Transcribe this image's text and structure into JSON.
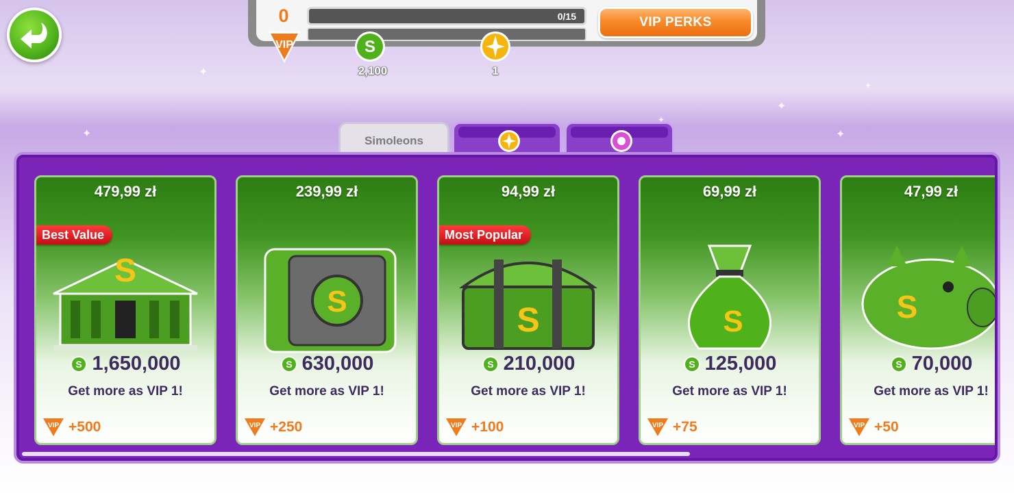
{
  "hud": {
    "vip_level": "0",
    "vip_label": "VIP",
    "vip_progress_text": "0/15",
    "vip_progress_fraction": 0,
    "vip_perks_label": "VIP PERKS",
    "simoleons_value": "2,100",
    "lifestyle_points_value": "1"
  },
  "tabs": [
    {
      "label": "Simoleons",
      "icon": "simoleon-icon",
      "active": true
    },
    {
      "label": "",
      "icon": "lifestyle-points-icon",
      "active": false
    },
    {
      "label": "",
      "icon": "social-points-icon",
      "active": false
    }
  ],
  "cards": [
    {
      "price": "479,99 zł",
      "tag": "Best Value",
      "art": "bank-icon",
      "amount": "1,650,000",
      "subtitle": "Get more as VIP 1!",
      "vip_label": "VIP",
      "bonus": "+500"
    },
    {
      "price": "239,99 zł",
      "tag": "",
      "art": "safe-icon",
      "amount": "630,000",
      "subtitle": "Get more as VIP 1!",
      "vip_label": "VIP",
      "bonus": "+250"
    },
    {
      "price": "94,99 zł",
      "tag": "Most Popular",
      "art": "treasure-chest-icon",
      "amount": "210,000",
      "subtitle": "Get more as VIP 1!",
      "vip_label": "VIP",
      "bonus": "+100"
    },
    {
      "price": "69,99 zł",
      "tag": "",
      "art": "money-bag-icon",
      "amount": "125,000",
      "subtitle": "Get more as VIP 1!",
      "vip_label": "VIP",
      "bonus": "+75"
    },
    {
      "price": "47,99 zł",
      "tag": "",
      "art": "piggy-bank-icon",
      "amount": "70,000",
      "subtitle": "Get more as VIP 1!",
      "vip_label": "VIP",
      "bonus": "+50"
    }
  ],
  "colors": {
    "panel_purple": "#7a24b8",
    "accent_orange": "#f07b1c",
    "card_green": "#3f9420",
    "text_dark_purple": "#3d2a5e"
  }
}
